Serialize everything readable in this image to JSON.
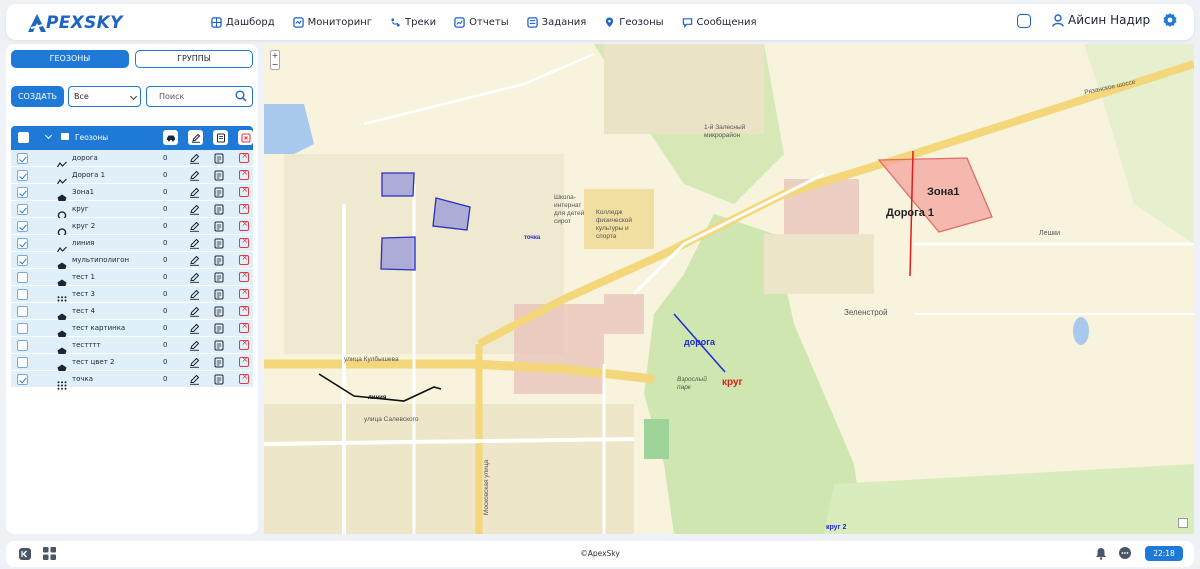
{
  "app": {
    "logo_text": "PEXSKY",
    "logo_letter": "A"
  },
  "nav": [
    {
      "label": "Дашборд",
      "icon": "dashboard-icon"
    },
    {
      "label": "Мониторинг",
      "icon": "monitoring-icon"
    },
    {
      "label": "Треки",
      "icon": "tracks-icon"
    },
    {
      "label": "Отчеты",
      "icon": "reports-icon"
    },
    {
      "label": "Задания",
      "icon": "tasks-icon"
    },
    {
      "label": "Геозоны",
      "icon": "geozone-pin-icon"
    },
    {
      "label": "Сообщения",
      "icon": "messages-icon"
    }
  ],
  "user": {
    "name": "Айсин Надир"
  },
  "sidebar": {
    "tabs": [
      "ГЕОЗОНЫ",
      "ГРУППЫ"
    ],
    "create_label": "СОЗДАТЬ",
    "filter_value": "Все",
    "search_placeholder": "Поиск",
    "list_header": "Геозоны",
    "items": [
      {
        "name": "дорога",
        "count": "0",
        "checked": true,
        "shape": "line"
      },
      {
        "name": "Дорога 1",
        "count": "0",
        "checked": true,
        "shape": "line"
      },
      {
        "name": "Зона1",
        "count": "0",
        "checked": true,
        "shape": "polygon"
      },
      {
        "name": "круг",
        "count": "0",
        "checked": true,
        "shape": "circle"
      },
      {
        "name": "круг 2",
        "count": "0",
        "checked": true,
        "shape": "circle"
      },
      {
        "name": "линия",
        "count": "0",
        "checked": true,
        "shape": "line"
      },
      {
        "name": "мультиполигон",
        "count": "0",
        "checked": true,
        "shape": "polygon"
      },
      {
        "name": "тест 1",
        "count": "0",
        "checked": false,
        "shape": "polygon"
      },
      {
        "name": "тест 3",
        "count": "0",
        "checked": false,
        "shape": "points"
      },
      {
        "name": "тест 4",
        "count": "0",
        "checked": false,
        "shape": "polygon"
      },
      {
        "name": "тест картинка",
        "count": "0",
        "checked": false,
        "shape": "polygon"
      },
      {
        "name": "тестттт",
        "count": "0",
        "checked": false,
        "shape": "polygon"
      },
      {
        "name": "тест цвет 2",
        "count": "0",
        "checked": false,
        "shape": "polygon"
      },
      {
        "name": "точка",
        "count": "0",
        "checked": true,
        "shape": "points"
      }
    ]
  },
  "map": {
    "zoom_in": "+",
    "zoom_out": "−",
    "labels": {
      "zone1": "Зона1",
      "road1": "Дорога 1",
      "road": "дорога",
      "circle": "круг",
      "circle2": "круг 2",
      "line": "линия",
      "point": "точка"
    },
    "streets": {
      "ryazan": "Рязанское шоссе",
      "kuybysheva": "улица Кулбышева",
      "salevskogo": "улица Салевского",
      "moskovskaya": "Московская улица",
      "zelenstroy": "Зеленстрой",
      "leshki": "Лешки",
      "school": "Школа-интернат для детей сирот",
      "college": "Колледж физической культуры и спорта",
      "park": "Взрослый парк",
      "mikrorayon": "1-й Залесный микрорайон"
    },
    "colors": {
      "polygon_blue": "#6b6fe0",
      "zone_red": "#f4a4a0",
      "road_red": "#e01b1b",
      "road_blue": "#1b2bd6"
    }
  },
  "footer": {
    "copyright": "©ApexSky",
    "time": "22:18"
  }
}
